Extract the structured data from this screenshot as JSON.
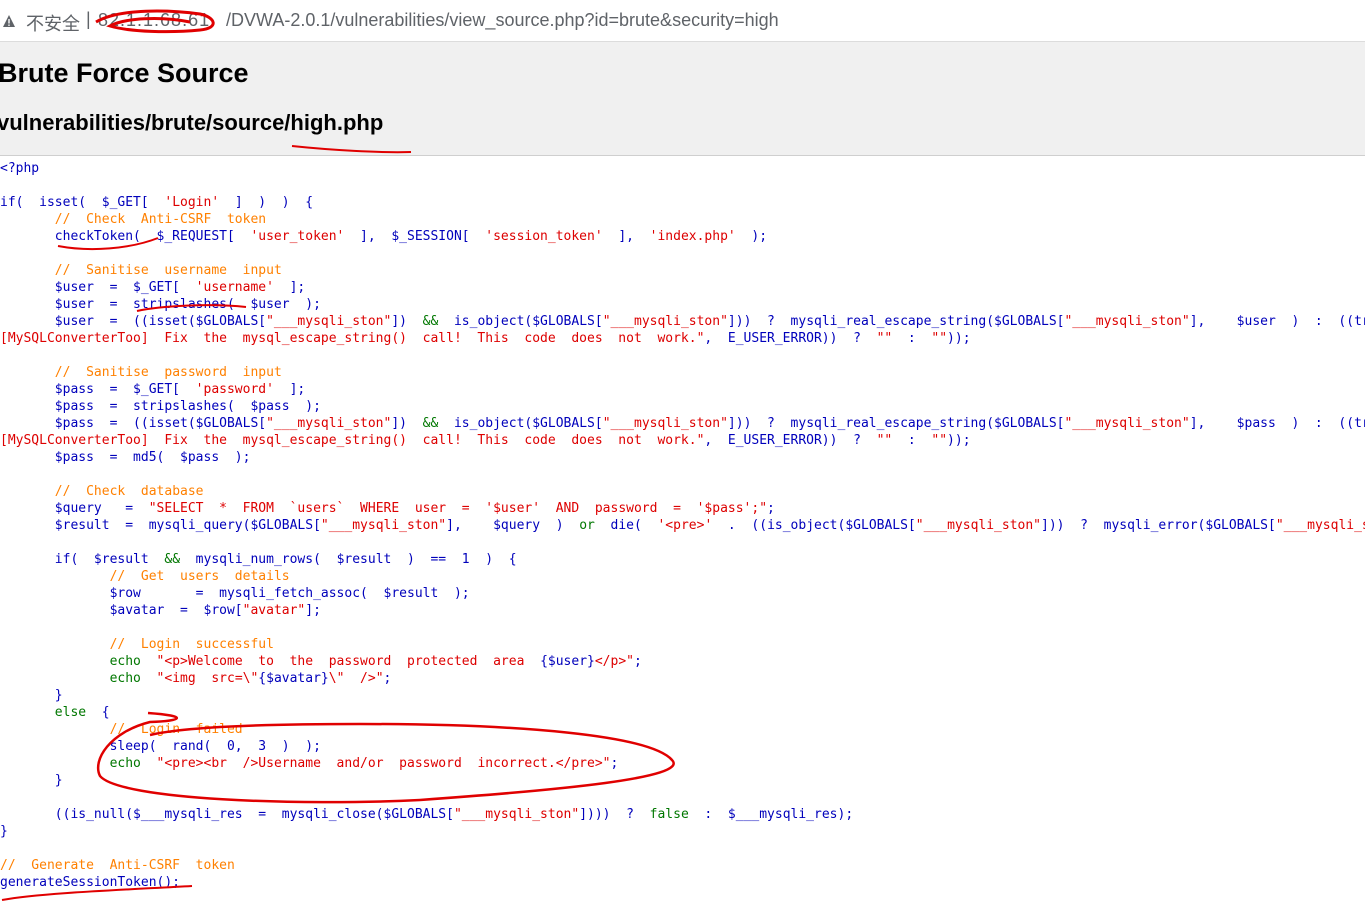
{
  "browser": {
    "security_label": "不安全",
    "separator": "|",
    "host_redacted": "82.1.1.68.61",
    "url_path": "/DVWA-2.0.1/vulnerabilities/view_source.php?id=brute&security=high",
    "icons": [
      "warning-icon"
    ]
  },
  "page": {
    "title": "Brute Force Source",
    "subtitle": "vulnerabilities/brute/source/high.php"
  },
  "colors": {
    "keyword": "#007700",
    "string": "#dd0000",
    "comment": "#ff8000",
    "default": "#0000bb",
    "annotation": "#e00000"
  },
  "code_lines": [
    [
      [
        "df",
        "<?php"
      ]
    ],
    [],
    [
      [
        "df",
        "if(  isset(  $_GET[  "
      ],
      [
        "st",
        "'Login'"
      ],
      [
        "df",
        "  ]  )  )  {"
      ]
    ],
    [
      [
        "df",
        "       "
      ],
      [
        "cm",
        "//  Check  Anti-CSRF  token"
      ]
    ],
    [
      [
        "df",
        "       checkToken(  $_REQUEST[  "
      ],
      [
        "st",
        "'user_token'"
      ],
      [
        "df",
        "  ],  $_SESSION[  "
      ],
      [
        "st",
        "'session_token'"
      ],
      [
        "df",
        "  ],  "
      ],
      [
        "st",
        "'index.php'"
      ],
      [
        "df",
        "  );"
      ]
    ],
    [],
    [
      [
        "df",
        "       "
      ],
      [
        "cm",
        "//  Sanitise  username  input"
      ]
    ],
    [
      [
        "df",
        "       $user  =  $_GET[  "
      ],
      [
        "st",
        "'username'"
      ],
      [
        "df",
        "  ];"
      ]
    ],
    [
      [
        "df",
        "       $user  =  stripslashes(  $user  );"
      ]
    ],
    [
      [
        "df",
        "       $user  =  ((isset($GLOBALS["
      ],
      [
        "st",
        "\"___mysqli_ston\""
      ],
      [
        "df",
        "])  "
      ],
      [
        "kw",
        "&&"
      ],
      [
        "df",
        "  is_object($GLOBALS["
      ],
      [
        "st",
        "\"___mysqli_ston\""
      ],
      [
        "df",
        "]))  ?  mysqli_real_escape_string($GLOBALS["
      ],
      [
        "st",
        "\"___mysqli_ston\""
      ],
      [
        "df",
        "],    $user  )  :  ((trigger_error("
      ],
      [
        "st",
        "\"[MySQLConverterToo]"
      ]
    ],
    [
      [
        "st",
        "[MySQLConverterToo]  Fix  the  mysql_escape_string()  call!  This  code  does  not  work.\""
      ],
      [
        "df",
        ",  E_USER_ERROR))  ?  "
      ],
      [
        "st",
        "\"\""
      ],
      [
        "df",
        "  :  "
      ],
      [
        "st",
        "\"\""
      ],
      [
        "df",
        "));"
      ]
    ],
    [],
    [
      [
        "df",
        "       "
      ],
      [
        "cm",
        "//  Sanitise  password  input"
      ]
    ],
    [
      [
        "df",
        "       $pass  =  $_GET[  "
      ],
      [
        "st",
        "'password'"
      ],
      [
        "df",
        "  ];"
      ]
    ],
    [
      [
        "df",
        "       $pass  =  stripslashes(  $pass  );"
      ]
    ],
    [
      [
        "df",
        "       $pass  =  ((isset($GLOBALS["
      ],
      [
        "st",
        "\"___mysqli_ston\""
      ],
      [
        "df",
        "])  "
      ],
      [
        "kw",
        "&&"
      ],
      [
        "df",
        "  is_object($GLOBALS["
      ],
      [
        "st",
        "\"___mysqli_ston\""
      ],
      [
        "df",
        "]))  ?  mysqli_real_escape_string($GLOBALS["
      ],
      [
        "st",
        "\"___mysqli_ston\""
      ],
      [
        "df",
        "],    $pass  )  :  ((trigger_error("
      ],
      [
        "st",
        "\"[MySQLConverterToo]"
      ]
    ],
    [
      [
        "st",
        "[MySQLConverterToo]  Fix  the  mysql_escape_string()  call!  This  code  does  not  work.\""
      ],
      [
        "df",
        ",  E_USER_ERROR))  ?  "
      ],
      [
        "st",
        "\"\""
      ],
      [
        "df",
        "  :  "
      ],
      [
        "st",
        "\"\""
      ],
      [
        "df",
        "));"
      ]
    ],
    [
      [
        "df",
        "       $pass  =  md5(  $pass  );"
      ]
    ],
    [],
    [
      [
        "df",
        "       "
      ],
      [
        "cm",
        "//  Check  database"
      ]
    ],
    [
      [
        "df",
        "       $query   =  "
      ],
      [
        "st",
        "\"SELECT  *  FROM  `users`  WHERE  user  =  '$user'  AND  password  =  '$pass';\""
      ],
      [
        "df",
        ";"
      ]
    ],
    [
      [
        "df",
        "       $result  =  mysqli_query($GLOBALS["
      ],
      [
        "st",
        "\"___mysqli_ston\""
      ],
      [
        "df",
        "],    $query  )  "
      ],
      [
        "kw",
        "or"
      ],
      [
        "df",
        "  die(  "
      ],
      [
        "st",
        "'<pre>'"
      ],
      [
        "df",
        "  .  ((is_object($GLOBALS["
      ],
      [
        "st",
        "\"___mysqli_ston\""
      ],
      [
        "df",
        "]))  ?  mysqli_error($GLOBALS["
      ],
      [
        "st",
        "\"___mysqli_ston\""
      ],
      [
        "df",
        "])"
      ]
    ],
    [],
    [
      [
        "df",
        "       if(  $result  "
      ],
      [
        "kw",
        "&&"
      ],
      [
        "df",
        "  mysqli_num_rows(  $result  )  ==  1  )  {"
      ]
    ],
    [
      [
        "df",
        "              "
      ],
      [
        "cm",
        "//  Get  users  details"
      ]
    ],
    [
      [
        "df",
        "              $row       =  mysqli_fetch_assoc(  $result  );"
      ]
    ],
    [
      [
        "df",
        "              $avatar  =  $row["
      ],
      [
        "st",
        "\"avatar\""
      ],
      [
        "df",
        "];"
      ]
    ],
    [],
    [
      [
        "df",
        "              "
      ],
      [
        "cm",
        "//  Login  successful"
      ]
    ],
    [
      [
        "df",
        "              "
      ],
      [
        "kw",
        "echo"
      ],
      [
        "df",
        "  "
      ],
      [
        "st",
        "\"<p>Welcome  to  the  password  protected  area  "
      ],
      [
        "df",
        "{$user}"
      ],
      [
        "st",
        "</p>\""
      ],
      [
        "df",
        ";"
      ]
    ],
    [
      [
        "df",
        "              "
      ],
      [
        "kw",
        "echo"
      ],
      [
        "df",
        "  "
      ],
      [
        "st",
        "\"<img  src=\\\""
      ],
      [
        "df",
        "{$avatar}"
      ],
      [
        "st",
        "\\\"  />\""
      ],
      [
        "df",
        ";"
      ]
    ],
    [
      [
        "df",
        "       }"
      ]
    ],
    [
      [
        "df",
        "       "
      ],
      [
        "kw",
        "else"
      ],
      [
        "df",
        "  {"
      ]
    ],
    [
      [
        "df",
        "              "
      ],
      [
        "cm",
        "//  Login  failed"
      ]
    ],
    [
      [
        "df",
        "              sleep(  rand(  0,  3  )  );"
      ]
    ],
    [
      [
        "df",
        "              "
      ],
      [
        "kw",
        "echo"
      ],
      [
        "df",
        "  "
      ],
      [
        "st",
        "\"<pre><br  />Username  and/or  password  incorrect.</pre>\""
      ],
      [
        "df",
        ";"
      ]
    ],
    [
      [
        "df",
        "       }"
      ]
    ],
    [],
    [
      [
        "df",
        "       ((is_null($___mysqli_res  =  mysqli_close($GLOBALS["
      ],
      [
        "st",
        "\"___mysqli_ston\""
      ],
      [
        "df",
        "])))  ?  "
      ],
      [
        "kw",
        "false"
      ],
      [
        "df",
        "  :  $___mysqli_res);"
      ]
    ],
    [
      [
        "df",
        "}"
      ]
    ],
    [],
    [
      [
        "cm",
        "//  Generate  Anti-CSRF  token"
      ]
    ],
    [
      [
        "df",
        "generateSessionToken();"
      ]
    ]
  ]
}
